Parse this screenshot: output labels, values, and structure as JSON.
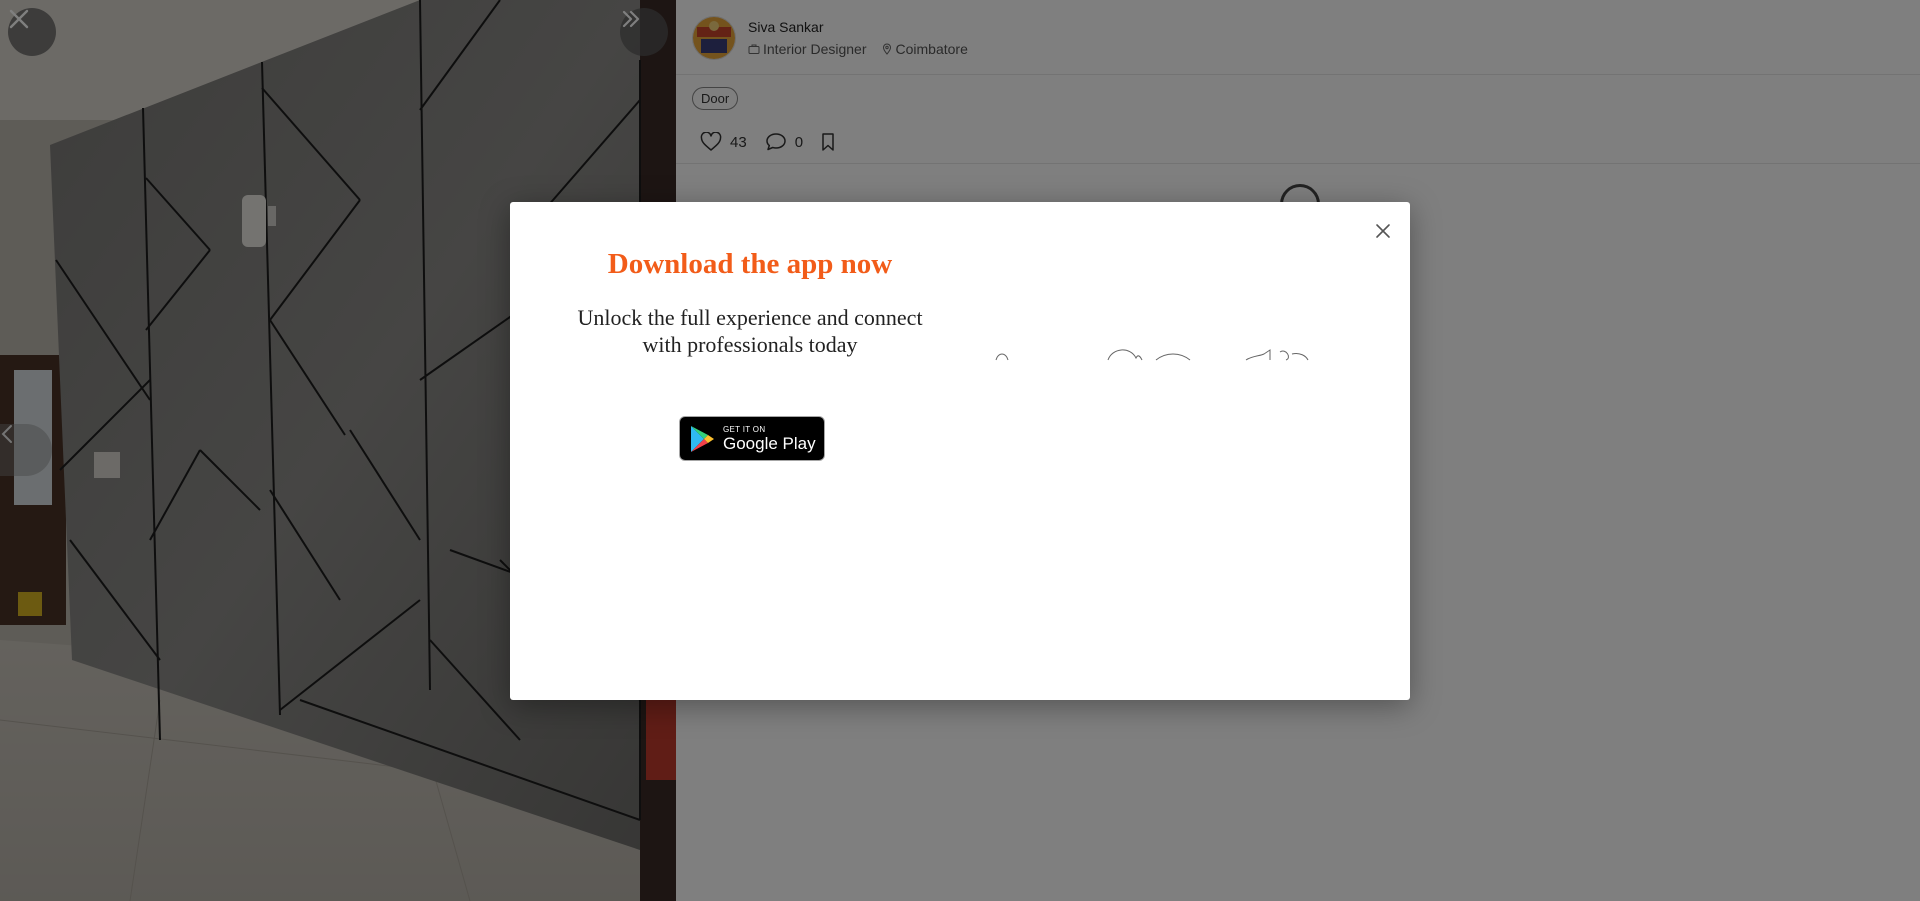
{
  "viewer": {
    "close_icon": "close-icon",
    "expand_icon": "double-chevron-right-icon",
    "prev_icon": "chevron-left-icon"
  },
  "author": {
    "name": "Siva Sankar",
    "role": "Interior Designer",
    "location": "Coimbatore"
  },
  "tags": [
    "Door"
  ],
  "stats": {
    "likes": "43",
    "comments": "0"
  },
  "modal": {
    "title": "Download the app now",
    "subtitle": "Unlock the full experience and connect with professionals today",
    "store_badge": {
      "small": "GET IT ON",
      "big": "Google Play"
    },
    "title_color": "#f25c19"
  }
}
